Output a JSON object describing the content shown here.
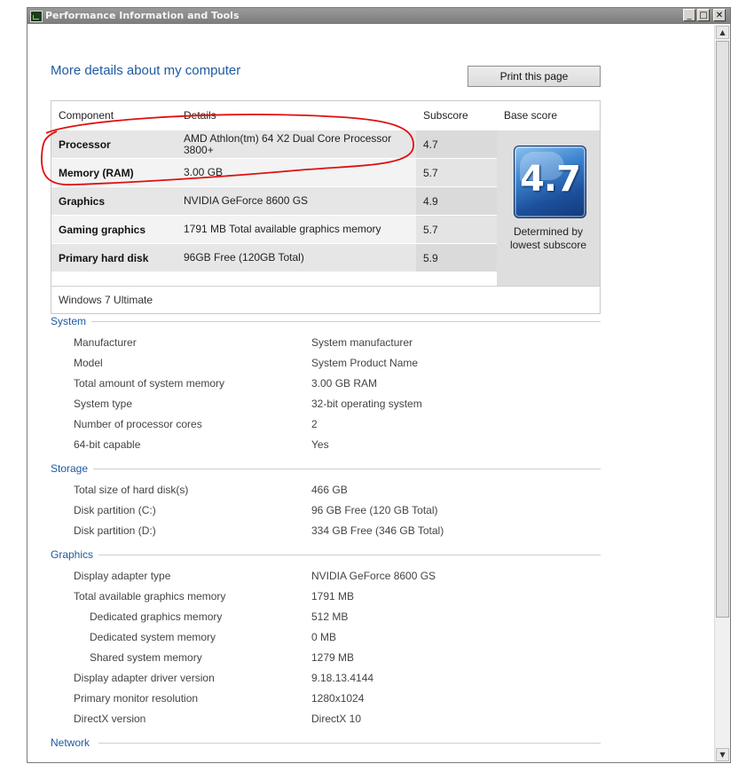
{
  "window": {
    "title": "Performance Information and Tools",
    "min_glyph": "_",
    "max_glyph": "□",
    "close_glyph": "✕"
  },
  "scroll": {
    "up": "▲",
    "down": "▼"
  },
  "page": {
    "title": "More details about my computer",
    "print_label": "Print this page"
  },
  "score_table": {
    "headers": {
      "component": "Component",
      "details": "Details",
      "subscore": "Subscore",
      "base": "Base score"
    },
    "rows": [
      {
        "component": "Processor",
        "details": "AMD Athlon(tm) 64 X2 Dual Core Processor 3800+",
        "subscore": "4.7"
      },
      {
        "component": "Memory (RAM)",
        "details": "3.00 GB",
        "subscore": "5.7"
      },
      {
        "component": "Graphics",
        "details": "NVIDIA GeForce 8600 GS",
        "subscore": "4.9"
      },
      {
        "component": "Gaming graphics",
        "details": "1791 MB Total available graphics memory",
        "subscore": "5.7"
      },
      {
        "component": "Primary hard disk",
        "details": "96GB Free (120GB Total)",
        "subscore": "5.9"
      }
    ],
    "base_score": "4.7",
    "base_caption": "Determined by lowest subscore",
    "os": "Windows 7 Ultimate"
  },
  "sections": {
    "system": {
      "title": "System",
      "items": [
        {
          "label": "Manufacturer",
          "value": "System manufacturer"
        },
        {
          "label": "Model",
          "value": "System Product Name"
        },
        {
          "label": "Total amount of system memory",
          "value": "3.00 GB RAM"
        },
        {
          "label": "System type",
          "value": "32-bit operating system"
        },
        {
          "label": "Number of processor cores",
          "value": "2"
        },
        {
          "label": "64-bit capable",
          "value": "Yes"
        }
      ]
    },
    "storage": {
      "title": "Storage",
      "items": [
        {
          "label": "Total size of hard disk(s)",
          "value": "466 GB"
        },
        {
          "label": "Disk partition (C:)",
          "value": "96 GB Free (120 GB Total)"
        },
        {
          "label": "Disk partition (D:)",
          "value": "334 GB Free (346 GB Total)"
        }
      ]
    },
    "graphics": {
      "title": "Graphics",
      "items": [
        {
          "label": "Display adapter type",
          "value": "NVIDIA GeForce 8600 GS"
        },
        {
          "label": "Total available graphics memory",
          "value": "1791 MB"
        },
        {
          "label": "Dedicated graphics memory",
          "value": "512 MB"
        },
        {
          "label": "Dedicated system memory",
          "value": "0 MB"
        },
        {
          "label": "Shared system memory",
          "value": "1279 MB"
        },
        {
          "label": "Display adapter driver version",
          "value": "9.18.13.4144"
        },
        {
          "label": "Primary monitor resolution",
          "value": "1280x1024"
        },
        {
          "label": "DirectX version",
          "value": "DirectX 10"
        }
      ]
    },
    "network": {
      "title": "Network"
    }
  },
  "colors": {
    "accent": "#1e5aa0",
    "annotation": "#e01010"
  }
}
